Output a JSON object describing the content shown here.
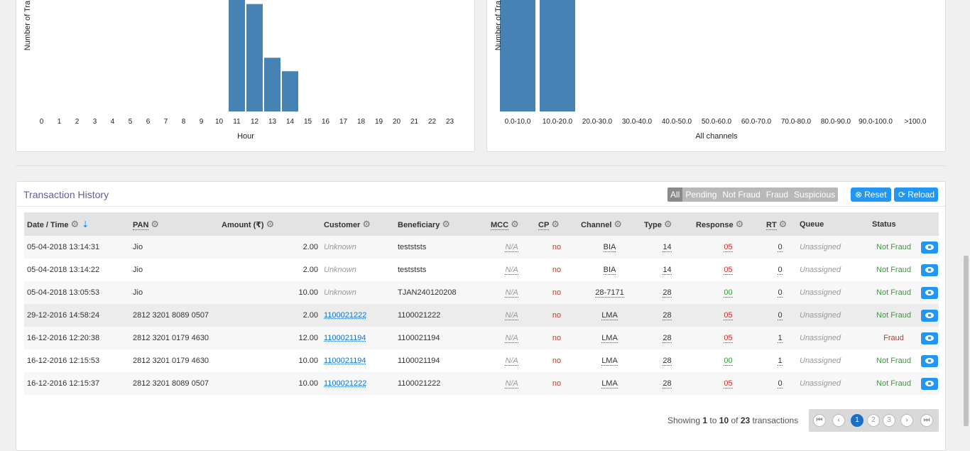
{
  "chart_data": [
    {
      "type": "bar",
      "xlabel": "Hour",
      "ylabel": "Number of Tra",
      "categories": [
        "0",
        "1",
        "2",
        "3",
        "4",
        "5",
        "6",
        "7",
        "8",
        "9",
        "10",
        "11",
        "12",
        "13",
        "14",
        "15",
        "16",
        "17",
        "18",
        "19",
        "20",
        "21",
        "22",
        "23"
      ],
      "values": [
        0,
        0,
        0,
        0,
        0,
        0,
        0,
        0,
        0,
        0,
        0,
        13,
        8,
        4,
        3,
        0,
        0,
        0,
        0,
        0,
        0,
        0,
        0,
        0
      ],
      "bar_color": "#4682b4"
    },
    {
      "type": "bar",
      "xlabel": "All channels",
      "ylabel": "Number of Tra",
      "categories": [
        "0.0-10.0",
        "10.0-20.0",
        "20.0-30.0",
        "30.0-40.0",
        "40.0-50.0",
        "50.0-60.0",
        "60.0-70.0",
        "70.0-80.0",
        "80.0-90.0",
        "90.0-100.0",
        ">100.0"
      ],
      "values": [
        14,
        9,
        0,
        0,
        0,
        0,
        0,
        0,
        0,
        0,
        0
      ],
      "bar_color": "#4682b4"
    }
  ],
  "transactions": {
    "title": "Transaction History",
    "filters": [
      "All",
      "Pending",
      "Not Fraud",
      "Fraud",
      "Suspicious"
    ],
    "reset_label": "Reset",
    "reload_label": "Reload",
    "columns": [
      "Date / Time",
      "PAN",
      "Amount (₹)",
      "Customer",
      "Beneficiary",
      "MCC",
      "CP",
      "Channel",
      "Type",
      "Response",
      "RT",
      "Queue",
      "Status"
    ],
    "rows": [
      {
        "datetime": "05-04-2018 13:14:31",
        "pan": "Jio",
        "amount": "2.00",
        "customer": "Unknown",
        "customer_link": false,
        "beneficiary": "testststs",
        "mcc": "N/A",
        "cp": "no",
        "channel": "BIA",
        "type": "14",
        "response": "05",
        "response_color": "red",
        "rt": "0",
        "queue": "Unassigned",
        "status": "Not Fraud",
        "status_color": "green"
      },
      {
        "datetime": "05-04-2018 13:14:22",
        "pan": "Jio",
        "amount": "2.00",
        "customer": "Unknown",
        "customer_link": false,
        "beneficiary": "testststs",
        "mcc": "N/A",
        "cp": "no",
        "channel": "BIA",
        "type": "14",
        "response": "05",
        "response_color": "red",
        "rt": "0",
        "queue": "Unassigned",
        "status": "Not Fraud",
        "status_color": "green"
      },
      {
        "datetime": "05-04-2018 13:05:53",
        "pan": "Jio",
        "amount": "10.00",
        "customer": "Unknown",
        "customer_link": false,
        "beneficiary": "TJAN240120208",
        "mcc": "N/A",
        "cp": "no",
        "channel": "28-7171",
        "type": "28",
        "response": "00",
        "response_color": "green",
        "rt": "0",
        "queue": "Unassigned",
        "status": "Not Fraud",
        "status_color": "green"
      },
      {
        "datetime": "29-12-2016 14:58:24",
        "pan": "2812 3201 8089 0507",
        "amount": "2.00",
        "customer": "1100021222",
        "customer_link": true,
        "beneficiary": "1100021222",
        "mcc": "N/A",
        "cp": "no",
        "channel": "LMA",
        "type": "28",
        "response": "05",
        "response_color": "red",
        "rt": "0",
        "queue": "Unassigned",
        "status": "Not Fraud",
        "status_color": "green"
      },
      {
        "datetime": "16-12-2016 12:20:38",
        "pan": "2812 3201 0179 4630",
        "amount": "12.00",
        "customer": "1100021194",
        "customer_link": true,
        "beneficiary": "1100021194",
        "mcc": "N/A",
        "cp": "no",
        "channel": "LMA",
        "type": "28",
        "response": "05",
        "response_color": "red",
        "rt": "1",
        "queue": "Unassigned",
        "status": "Fraud",
        "status_color": "red"
      },
      {
        "datetime": "16-12-2016 12:15:53",
        "pan": "2812 3201 0179 4630",
        "amount": "10.00",
        "customer": "1100021194",
        "customer_link": true,
        "beneficiary": "1100021194",
        "mcc": "N/A",
        "cp": "no",
        "channel": "LMA",
        "type": "28",
        "response": "00",
        "response_color": "green",
        "rt": "1",
        "queue": "Unassigned",
        "status": "Not Fraud",
        "status_color": "green"
      },
      {
        "datetime": "16-12-2016 12:15:37",
        "pan": "2812 3201 8089 0507",
        "amount": "10.00",
        "customer": "1100021222",
        "customer_link": true,
        "beneficiary": "1100021222",
        "mcc": "N/A",
        "cp": "no",
        "channel": "LMA",
        "type": "28",
        "response": "05",
        "response_color": "red",
        "rt": "0",
        "queue": "Unassigned",
        "status": "Not Fraud",
        "status_color": "green"
      }
    ],
    "footer": {
      "prefix": "Showing",
      "from": "1",
      "to_word": "to",
      "to": "10",
      "of_word": "of",
      "total": "23",
      "suffix": "transactions"
    },
    "pages": [
      "1",
      "2",
      "3"
    ]
  }
}
